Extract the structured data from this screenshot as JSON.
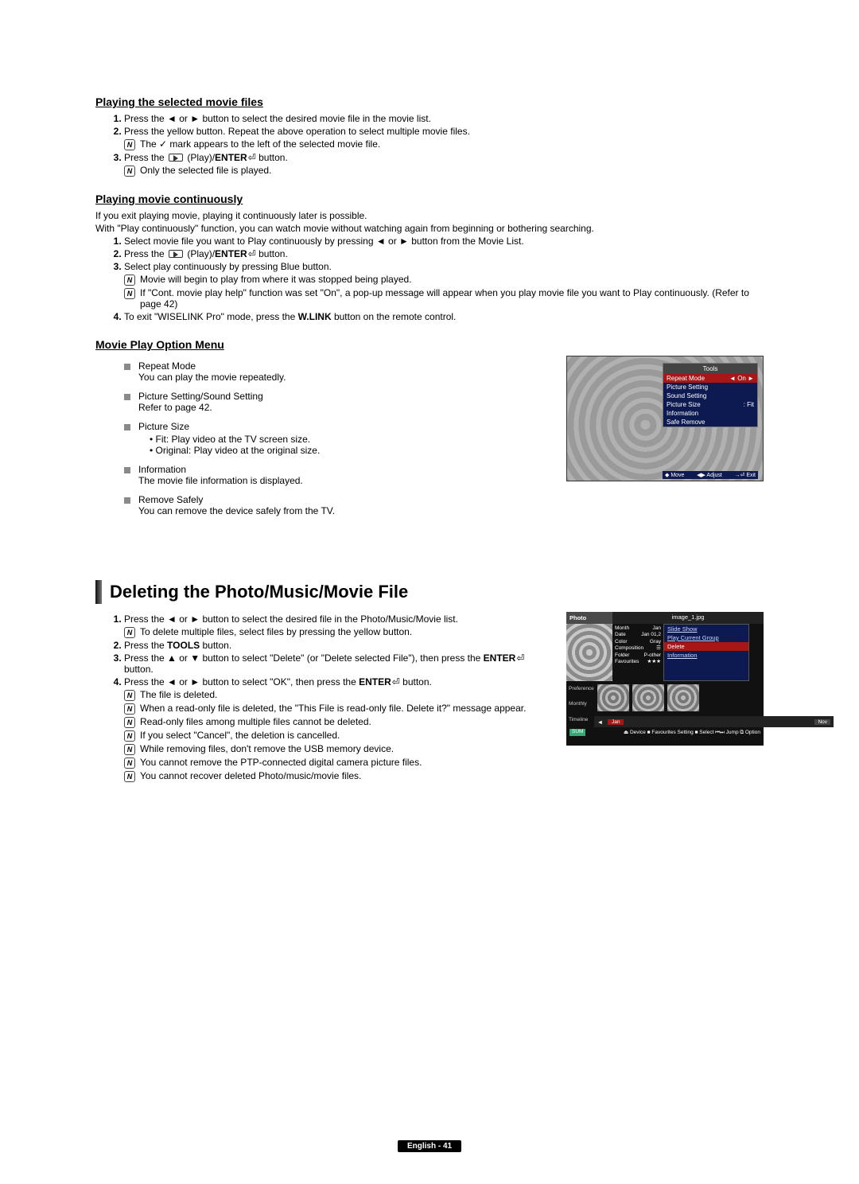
{
  "sec1": {
    "heading": "Playing the selected movie files",
    "item1": {
      "pre": "Press the ◄ or ► button to select the desired movie file in the movie list."
    },
    "item2": {
      "pre": "Press the yellow button. Repeat the above operation to select multiple movie files.",
      "note": "The ✓ mark appears to the left of the selected movie file."
    },
    "item3": {
      "pre_a": "Press the ",
      "pre_b": " (Play)/",
      "pre_c": "ENTER",
      "pre_d": " button.",
      "note": "Only the selected file is played."
    }
  },
  "sec2": {
    "heading": "Playing movie continuously",
    "intro1": "If you exit playing movie, playing it continuously later is possible.",
    "intro2": "With \"Play continuously\" function, you can watch movie without watching again from beginning or bothering searching.",
    "item1": "Select movie file you want to Play continuously by pressing ◄ or ► button from the Movie List.",
    "item2_a": "Press the ",
    "item2_b": " (Play)/",
    "item2_c": "ENTER",
    "item2_d": " button.",
    "item3": {
      "main": "Select play continuously by pressing Blue button.",
      "note1": "Movie will begin to play from where it was stopped being played.",
      "note2": "If \"Cont. movie play help\" function was set \"On\", a pop-up message will appear when you play movie file you want to Play continuously. (Refer to page 42)"
    },
    "item4_a": "To exit \"WISELINK Pro\" mode, press the ",
    "item4_b": "W.LINK",
    "item4_c": " button on the remote control."
  },
  "sec3": {
    "heading": "Movie Play Option Menu",
    "items": [
      {
        "title": "Repeat Mode",
        "desc": "You can play the movie repeatedly."
      },
      {
        "title": "Picture Setting/Sound Setting",
        "desc": "Refer to page 42."
      },
      {
        "title": "Picture Size",
        "sub": [
          "Fit: Play video at the TV screen size.",
          "Original: Play video at the original size."
        ]
      },
      {
        "title": "Information",
        "desc": "The movie file information is displayed."
      },
      {
        "title": "Remove Safely",
        "desc": "You can remove the device safely from the TV."
      }
    ]
  },
  "tools": {
    "title": "Tools",
    "rows": [
      {
        "l": "Repeat Mode",
        "r": "◄   On   ►",
        "sel": true
      },
      {
        "l": "Picture Setting",
        "r": ""
      },
      {
        "l": "Sound Setting",
        "r": ""
      },
      {
        "l": "Picture Size",
        "r": ":      Fit"
      },
      {
        "l": "Information",
        "r": ""
      },
      {
        "l": "Safe Remove",
        "r": ""
      }
    ],
    "footer": {
      "move": "◆ Move",
      "adjust": "◀▶ Adjust",
      "exit": "→⏎ Exit"
    }
  },
  "sec4": {
    "heading": "Deleting the Photo/Music/Movie File",
    "item1": {
      "main": "Press the ◄ or ► button to select the desired file in the Photo/Music/Movie list.",
      "note": "To delete multiple files, select files by pressing the yellow button."
    },
    "item2_a": "Press the ",
    "item2_b": "TOOLS",
    "item2_c": " button.",
    "item3_a": "Press the ▲ or ▼ button to select \"Delete\" (or \"Delete selected File\"), then press the ",
    "item3_b": "ENTER",
    "item3_c": " button.",
    "item4_a": "Press the ◄ or ► button to select \"OK\", then press the ",
    "item4_b": "ENTER",
    "item4_c": " button.",
    "notes": [
      "The file is deleted.",
      "When a read-only file is deleted, the \"This File is read-only file. Delete it?\" message appear.",
      "Read-only files among multiple files cannot be deleted.",
      "If you select \"Cancel\", the deletion is cancelled.",
      "While removing files, don't remove the USB memory device.",
      "You cannot remove the PTP-connected digital camera picture files.",
      "You cannot recover deleted Photo/music/movie files."
    ]
  },
  "photoShot": {
    "corner": "Photo",
    "fname": "image_1.jpg",
    "meta": [
      [
        "Month",
        "Jan"
      ],
      [
        "Date",
        "Jan 01,2"
      ],
      [
        "Color",
        "Gray"
      ],
      [
        "Composition",
        "☰"
      ],
      [
        "Folder",
        "P-other"
      ],
      [
        "Favourites",
        "★★★"
      ]
    ],
    "menu": [
      "Slide Show",
      "Play Current Group",
      "Delete",
      "Information"
    ],
    "menu_sel_index": 2,
    "left_labels": [
      "Preference",
      "Monthly",
      "Timeline"
    ],
    "months": [
      "Jan",
      "",
      "",
      "",
      "",
      "",
      "",
      "",
      "",
      "",
      "Nov"
    ],
    "footer_left": "SUM",
    "footer_right": "⏏ Device  ■ Favourites Setting  ■ Select  ⏮⏭ Jump  ⧉ Option"
  },
  "footer": "English - 41"
}
